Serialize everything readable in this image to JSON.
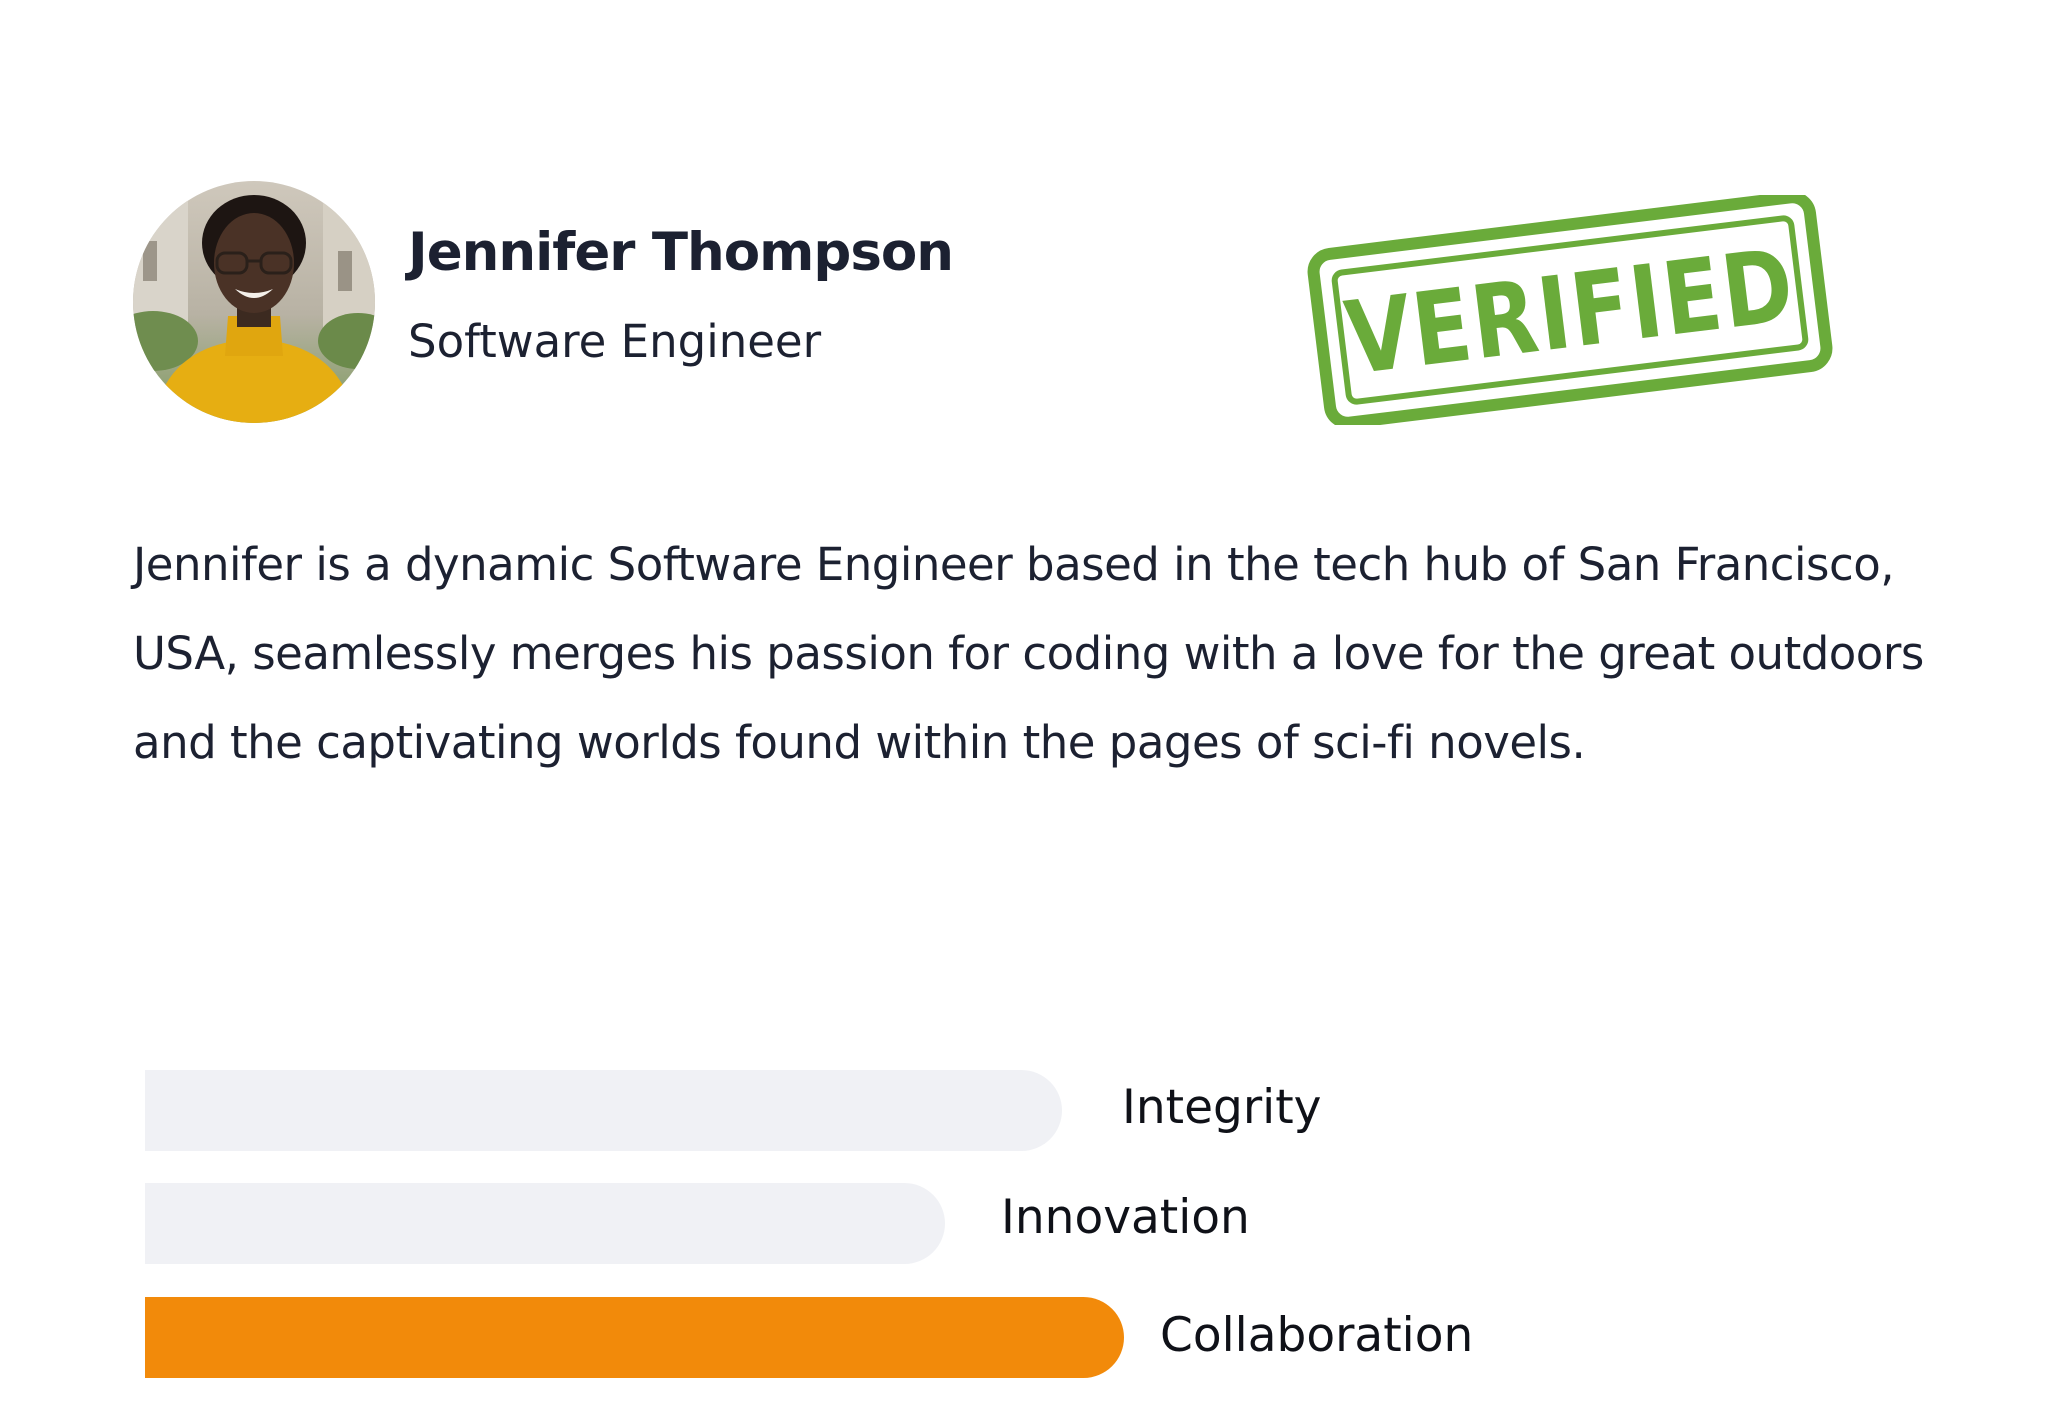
{
  "profile": {
    "name": "Jennifer Thompson",
    "role": "Software Engineer",
    "avatar_icon": "person-photo",
    "bio": "Jennifer is a dynamic Software Engineer based in the tech hub of San Francisco, USA, seamlessly merges his passion for coding with a love for the great outdoors and the captivating worlds found within the pages of sci-fi novels."
  },
  "stamp": {
    "text": "VERIFIED",
    "color": "#6aab3a"
  },
  "traits": [
    {
      "label": "Integrity",
      "active": false,
      "color": "#f0f1f5"
    },
    {
      "label": "Innovation",
      "active": false,
      "color": "#f0f1f5"
    },
    {
      "label": "Collaboration",
      "active": true,
      "color": "#f28a0a"
    }
  ]
}
